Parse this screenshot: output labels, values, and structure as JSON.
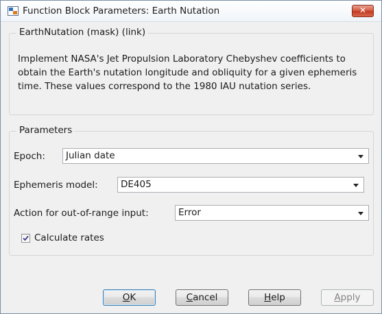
{
  "window": {
    "title": "Function Block Parameters: Earth Nutation",
    "close_glyph": "✕"
  },
  "mask": {
    "heading": "EarthNutation (mask) (link)",
    "description": "Implement NASA's Jet Propulsion Laboratory Chebyshev coefficients to obtain the Earth's nutation longitude and obliquity for a given ephemeris time. These values correspond to the 1980 IAU nutation series."
  },
  "parameters": {
    "heading": "Parameters",
    "epoch": {
      "label": "Epoch:",
      "value": "Julian date"
    },
    "ephemeris": {
      "label": "Ephemeris model:",
      "value": "DE405"
    },
    "action": {
      "label": "Action for out-of-range input:",
      "value": "Error"
    },
    "calculate_rates": {
      "label": "Calculate rates",
      "checked": true
    }
  },
  "buttons": {
    "ok": {
      "first": "O",
      "rest": "K"
    },
    "cancel": {
      "first": "C",
      "rest": "ancel"
    },
    "help": {
      "first": "H",
      "rest": "elp"
    },
    "apply": {
      "first": "A",
      "rest": "pply"
    }
  },
  "colors": {
    "close_button": "#c9432a",
    "default_button_border": "#3c7fb1",
    "checkmark": "#3a3a8c"
  },
  "icons": {
    "app": "simulink-block-icon",
    "close": "close-icon",
    "dropdown": "chevron-down-icon",
    "check": "checkmark-icon"
  }
}
